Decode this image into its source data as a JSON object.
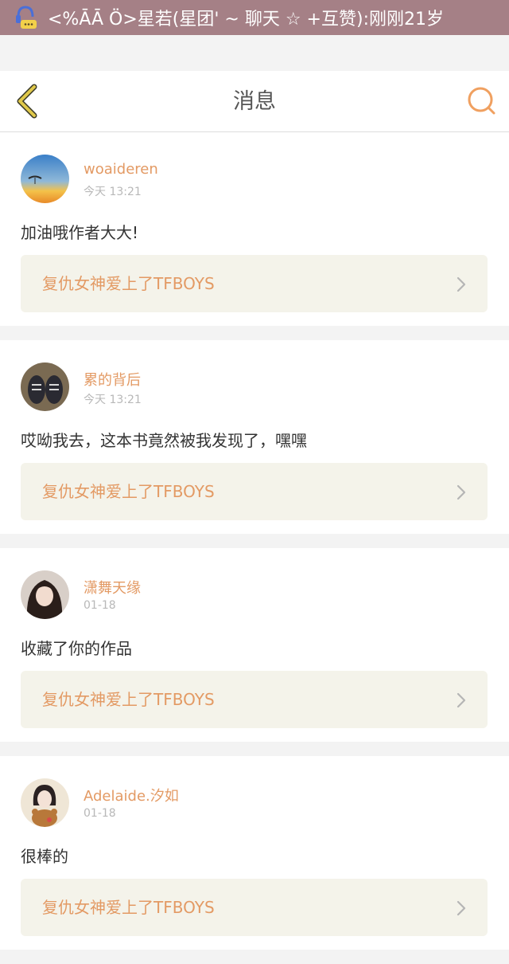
{
  "notification": {
    "icon": "qq-chat-icon",
    "text": "<%ĀĀ Ö>星若(星团' ~ 聊天 ☆ +互赞):刚刚21岁"
  },
  "header": {
    "title": "消息",
    "back_icon": "chevron-left-icon",
    "search_icon": "search-icon",
    "accent_color": "#f0a060",
    "back_color": "#d8c048"
  },
  "messages": [
    {
      "username": "woaideren",
      "time": "今天 13:21",
      "text": "加油哦作者大大!",
      "book_title": "复仇女神爱上了TFBOYS"
    },
    {
      "username": "累的背后",
      "time": "今天 13:21",
      "text": "哎呦我去，这本书竟然被我发现了，嘿嘿",
      "book_title": "复仇女神爱上了TFBOYS"
    },
    {
      "username": "潇舞天缘",
      "time": "01-18",
      "text": "收藏了你的作品",
      "book_title": "复仇女神爱上了TFBOYS"
    },
    {
      "username": "Adelaide.汐如",
      "time": "01-18",
      "text": "很棒的",
      "book_title": "复仇女神爱上了TFBOYS"
    }
  ]
}
